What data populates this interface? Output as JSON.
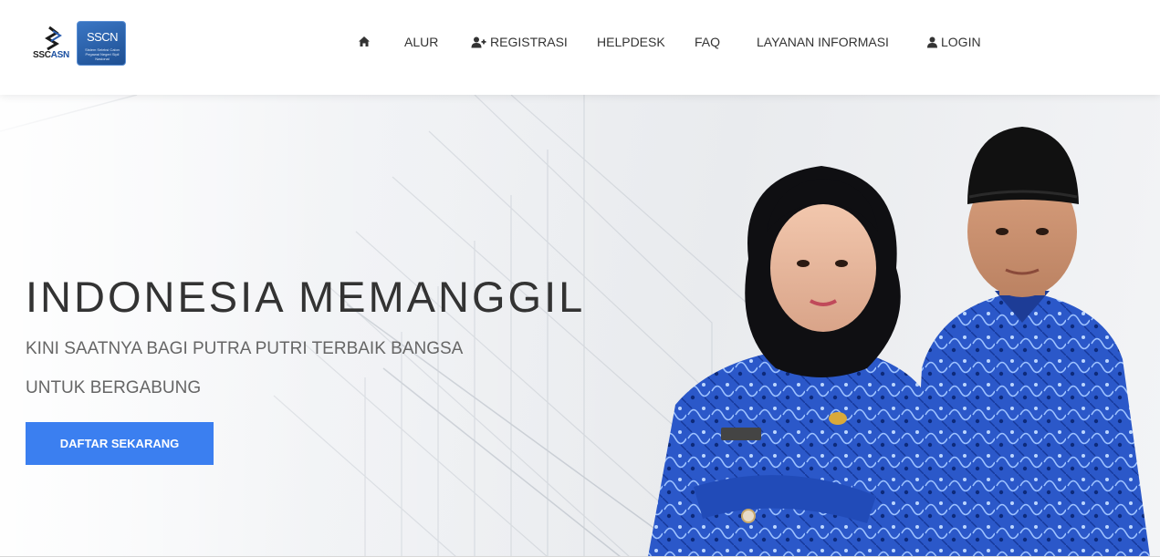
{
  "logo": {
    "asn_text_prefix": "SSC",
    "asn_text_suffix": "ASN",
    "sscn_title": "SSCN",
    "sscn_subtitle": "Sistem Seleksi Calon Pegawai Negeri Sipil Nasional"
  },
  "nav": {
    "home_icon": "home-icon",
    "items": [
      {
        "label": "ALUR"
      },
      {
        "label": "REGISTRASI",
        "icon": "user-plus-icon"
      },
      {
        "label": "HELPDESK"
      },
      {
        "label": "FAQ"
      },
      {
        "label": "LAYANAN INFORMASI"
      },
      {
        "label": "LOGIN",
        "icon": "user-icon"
      }
    ]
  },
  "hero": {
    "title": "INDONESIA MEMANGGIL",
    "subtitle_line1": "KINI SAATNYA BAGI PUTRA PUTRI TERBAIK BANGSA",
    "subtitle_line2": "UNTUK BERGABUNG",
    "cta_label": "DAFTAR SEKARANG"
  },
  "colors": {
    "accent": "#3b7ff0",
    "text_dark": "#333333",
    "text_muted": "#666666",
    "uniform_blue": "#2f5fd0"
  }
}
